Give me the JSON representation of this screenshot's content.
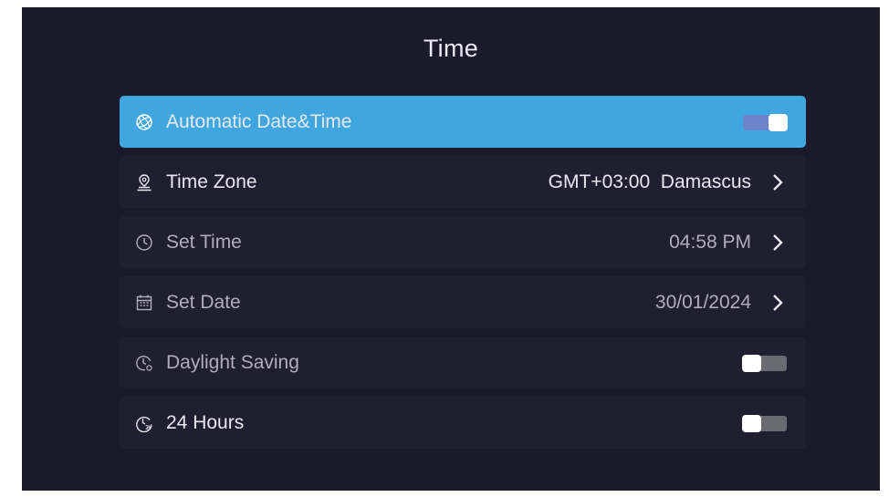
{
  "page": {
    "title": "Time"
  },
  "settings": {
    "automatic": {
      "label": "Automatic Date&Time",
      "icon": "globe-icon",
      "toggle_on": true
    },
    "time_zone": {
      "label": "Time Zone",
      "icon": "location-pin-icon",
      "value": "GMT+03:00  Damascus"
    },
    "set_time": {
      "label": "Set Time",
      "icon": "clock-icon",
      "value": "04:58 PM"
    },
    "set_date": {
      "label": "Set Date",
      "icon": "calendar-icon",
      "value": "30/01/2024"
    },
    "daylight_saving": {
      "label": "Daylight Saving",
      "icon": "daylight-clock-icon",
      "toggle_on": false
    },
    "hours_24": {
      "label": "24 Hours",
      "icon": "24h-clock-icon",
      "toggle_on": false
    }
  },
  "colors": {
    "background": "#1b1a2b",
    "row_background": "#201f30",
    "active_row": "#3fa6e0",
    "toggle_on": "#6b84c9",
    "toggle_off": "#6a6a72"
  }
}
